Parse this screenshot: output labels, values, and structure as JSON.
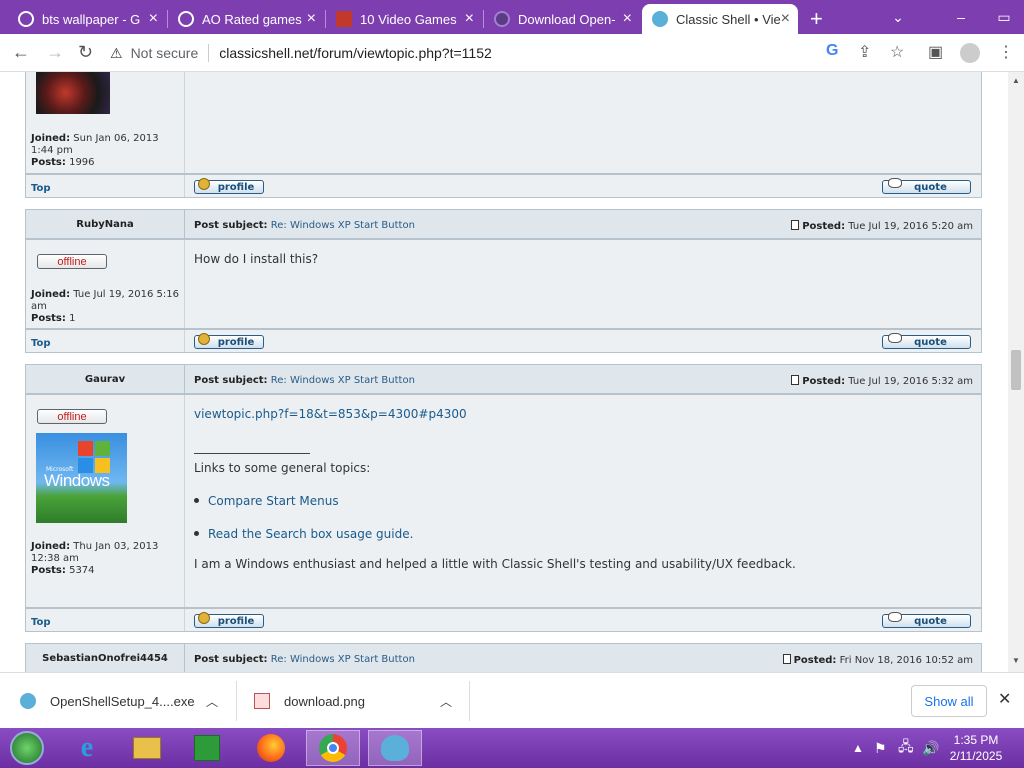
{
  "browser": {
    "tabs": [
      {
        "title": "bts wallpaper - G",
        "active": false
      },
      {
        "title": "AO Rated games",
        "active": false
      },
      {
        "title": "10 Video Games",
        "active": false
      },
      {
        "title": "Download Open-",
        "active": false
      },
      {
        "title": "Classic Shell • Vie",
        "active": true
      }
    ],
    "security_label": "Not secure",
    "url": "classicshell.net/forum/viewtopic.php?t=1152"
  },
  "posts": [
    {
      "meta": {
        "joined_label": "Joined:",
        "joined": "Sun Jan 06, 2013 1:44 pm",
        "posts_label": "Posts:",
        "posts": "1996"
      },
      "footer": {
        "top": "Top",
        "profile": "profile",
        "quote": "quote"
      }
    },
    {
      "author": "RubyNana",
      "subject_label": "Post subject:",
      "subject": "Re: Windows XP Start Button",
      "posted_label": "Posted:",
      "posted": "Tue Jul 19, 2016 5:20 am",
      "status": "offline",
      "meta": {
        "joined_label": "Joined:",
        "joined": "Tue Jul 19, 2016 5:16 am",
        "posts_label": "Posts:",
        "posts": "1"
      },
      "body": "How do I install this?",
      "footer": {
        "top": "Top",
        "profile": "profile",
        "quote": "quote"
      }
    },
    {
      "author": "Gaurav",
      "subject_label": "Post subject:",
      "subject": "Re: Windows XP Start Button",
      "posted_label": "Posted:",
      "posted": "Tue Jul 19, 2016 5:32 am",
      "status": "offline",
      "avatar_text": "Windows",
      "avatar_small": "Microsoft",
      "meta": {
        "joined_label": "Joined:",
        "joined": "Thu Jan 03, 2013 12:38 am",
        "posts_label": "Posts:",
        "posts": "5374"
      },
      "body_link": "viewtopic.php?f=18&t=853&p=4300#p4300",
      "sig_intro": "Links to some general topics:",
      "sig_links": [
        "Compare Start Menus",
        "Read the Search box usage guide."
      ],
      "sig_text": "I am a Windows enthusiast and helped a little with Classic Shell's testing and usability/UX feedback.",
      "footer": {
        "top": "Top",
        "profile": "profile",
        "quote": "quote"
      }
    },
    {
      "author": "SebastianOnofrei4454",
      "subject_label": "Post subject:",
      "subject": "Re: Windows XP Start Button",
      "posted_label": "Posted:",
      "posted": "Fri Nov 18, 2016 10:52 am"
    }
  ],
  "downloads": {
    "items": [
      {
        "name": "OpenShellSetup_4....exe"
      },
      {
        "name": "download.png"
      }
    ],
    "show_all": "Show all"
  },
  "taskbar": {
    "time": "1:35 PM",
    "date": "2/11/2025"
  },
  "colors": {
    "tabbar": "#7d3fb0",
    "forum_bg": "#ecf0f3",
    "link": "#1a5b8c",
    "offline_text": "#c02020"
  }
}
